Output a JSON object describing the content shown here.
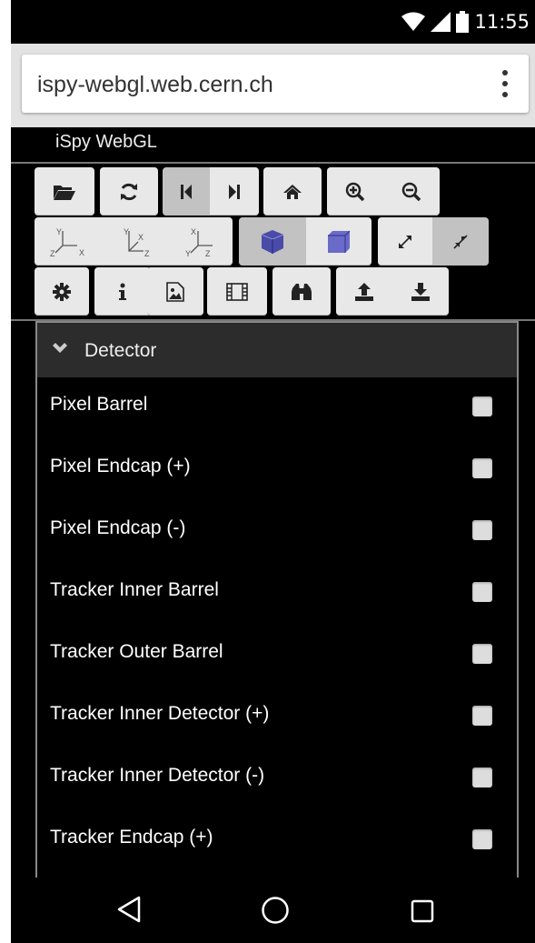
{
  "status_bar": {
    "time": "11:55",
    "icons": [
      "wifi-icon",
      "signal-icon",
      "battery-icon"
    ]
  },
  "browser": {
    "url": "ispy-webgl.web.cern.ch",
    "menu_icon": "more-vert-icon"
  },
  "app": {
    "title": "iSpy WebGL"
  },
  "toolbar": {
    "row1": [
      "open-folder-icon",
      "refresh-icon",
      "first-event-icon",
      "last-event-icon",
      "home-icon",
      "zoom-in-icon",
      "zoom-out-icon"
    ],
    "row2": [
      "view-yx-icon",
      "view-yz-icon",
      "view-xz-icon",
      "perspective-cube-icon",
      "orthographic-cube-icon",
      "enter-fullscreen-icon",
      "exit-fullscreen-icon"
    ],
    "row3": [
      "settings-icon",
      "info-icon",
      "image-icon",
      "film-icon",
      "binoculars-icon",
      "upload-icon",
      "download-icon"
    ],
    "axis_labels": {
      "yx": [
        "Y",
        "X",
        "Z"
      ],
      "yz": [
        "Y",
        "X",
        "Z"
      ],
      "xz": [
        "X",
        "Y",
        "Z"
      ]
    }
  },
  "panel": {
    "title": "Detector",
    "items": [
      {
        "label": "Pixel Barrel",
        "checked": false
      },
      {
        "label": "Pixel Endcap (+)",
        "checked": false
      },
      {
        "label": "Pixel Endcap (-)",
        "checked": false
      },
      {
        "label": "Tracker Inner Barrel",
        "checked": false
      },
      {
        "label": "Tracker Outer Barrel",
        "checked": false
      },
      {
        "label": "Tracker Inner Detector (+)",
        "checked": false
      },
      {
        "label": "Tracker Inner Detector (-)",
        "checked": false
      },
      {
        "label": "Tracker Endcap (+)",
        "checked": false
      }
    ]
  },
  "nav_bar": [
    "back-icon",
    "home-circle-icon",
    "recents-icon"
  ],
  "colors": {
    "background": "#000000",
    "button": "#e8e8e8",
    "button_active": "#c2c2c2",
    "panel_header": "#2c2c2c",
    "cube_blue": "#4a4aa8"
  }
}
